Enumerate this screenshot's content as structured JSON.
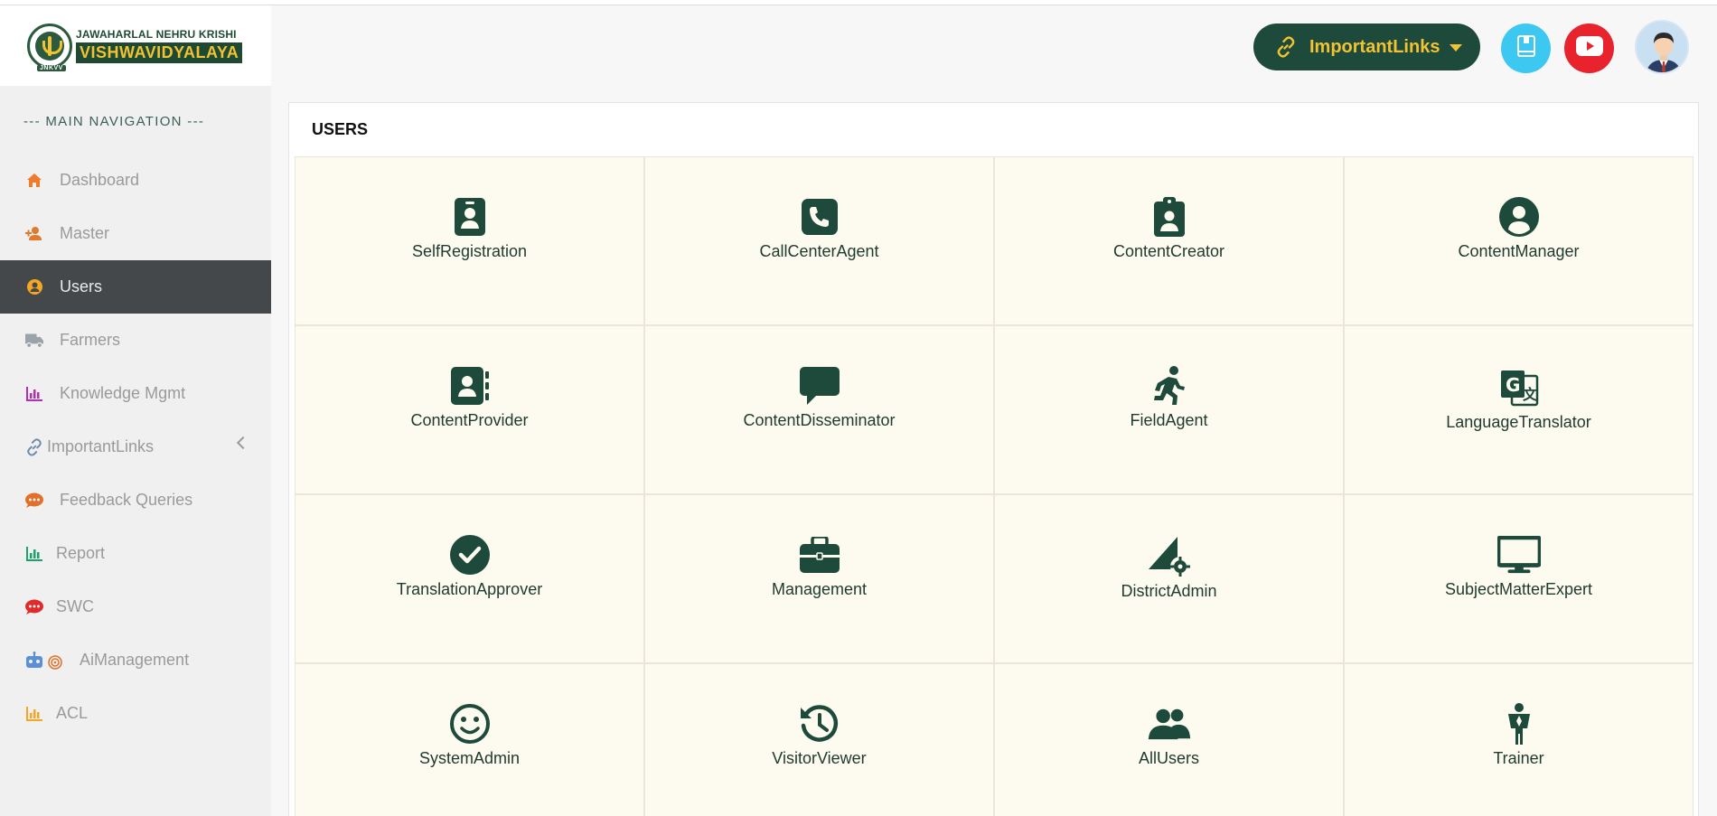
{
  "logo": {
    "line1": "JAWAHARLAL NEHRU KRISHI",
    "line2": "VISHWAVIDYALAYA",
    "tag": "JNKVV"
  },
  "sidebar": {
    "header": "--- MAIN NAVIGATION ---",
    "items": [
      {
        "label": "Dashboard",
        "icon": "home-icon",
        "color": "#f07c2a"
      },
      {
        "label": "Master",
        "icon": "user-plus-icon",
        "color": "#e07a2c"
      },
      {
        "label": "Users",
        "icon": "user-circle-icon",
        "color": "#f5a623",
        "active": true
      },
      {
        "label": "Farmers",
        "icon": "truck-icon",
        "color": "#9aa3a8"
      },
      {
        "label": "Knowledge Mgmt",
        "icon": "bar-chart-icon",
        "color": "#b52fb5"
      },
      {
        "label": "ImportantLinks",
        "icon": "link-icon",
        "color": "#6d8aa8"
      },
      {
        "label": "Feedback Queries",
        "icon": "comment-dots-icon",
        "color": "#e0702a"
      },
      {
        "label": "Report",
        "icon": "bar-chart-icon",
        "color": "#1aa36a"
      },
      {
        "label": "SWC",
        "icon": "comment-dots-icon",
        "color": "#e02b2b"
      },
      {
        "label": "AiManagement",
        "icon": "robot-icon",
        "color": "#5b8fd6"
      },
      {
        "label": "ACL",
        "icon": "bar-chart-icon",
        "color": "#f5a623"
      }
    ]
  },
  "header": {
    "links_label": "ImportantLinks"
  },
  "card": {
    "title": "USERS",
    "tiles": [
      {
        "label": "SelfRegistration",
        "icon": "id-badge-icon"
      },
      {
        "label": "CallCenterAgent",
        "icon": "phone-square-icon"
      },
      {
        "label": "ContentCreator",
        "icon": "clipboard-user-icon"
      },
      {
        "label": "ContentManager",
        "icon": "user-circle-icon"
      },
      {
        "label": "ContentProvider",
        "icon": "address-book-icon"
      },
      {
        "label": "ContentDisseminator",
        "icon": "comment-icon"
      },
      {
        "label": "FieldAgent",
        "icon": "running-icon"
      },
      {
        "label": "LanguageTranslator",
        "icon": "translate-icon"
      },
      {
        "label": "TranslationApprover",
        "icon": "check-circle-icon"
      },
      {
        "label": "Management",
        "icon": "briefcase-icon"
      },
      {
        "label": "DistrictAdmin",
        "icon": "signal-gear-icon"
      },
      {
        "label": "SubjectMatterExpert",
        "icon": "monitor-icon"
      },
      {
        "label": "SystemAdmin",
        "icon": "smile-icon"
      },
      {
        "label": "VisitorViewer",
        "icon": "history-icon"
      },
      {
        "label": "AllUsers",
        "icon": "users-icon"
      },
      {
        "label": "Trainer",
        "icon": "child-icon"
      }
    ]
  },
  "colors": {
    "primary": "#1e4a3c",
    "accent": "#f1c232",
    "tile_bg": "#fdfaef",
    "active_nav": "#45484a"
  }
}
